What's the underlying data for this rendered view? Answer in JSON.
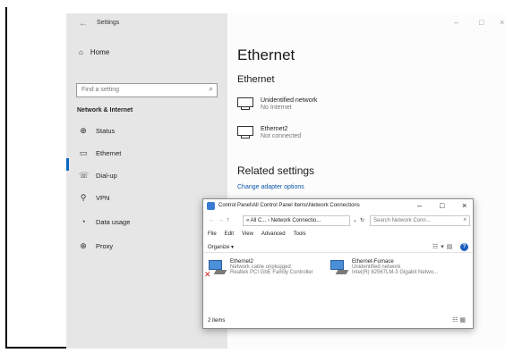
{
  "settings": {
    "window_title": "Settings",
    "home_label": "Home",
    "search_placeholder": "Find a setting",
    "section_title": "Network & Internet",
    "nav_items": [
      {
        "label": "Status",
        "icon": "globe-icon"
      },
      {
        "label": "Ethernet",
        "icon": "ethernet-icon",
        "selected": true
      },
      {
        "label": "Dial-up",
        "icon": "dialup-icon"
      },
      {
        "label": "VPN",
        "icon": "vpn-icon"
      },
      {
        "label": "Data usage",
        "icon": "data-usage-icon"
      },
      {
        "label": "Proxy",
        "icon": "proxy-icon"
      }
    ],
    "page_title": "Ethernet",
    "page_subtitle": "Ethernet",
    "networks": [
      {
        "name": "Unidentified network",
        "status": "No Internet"
      },
      {
        "name": "Ethernet2",
        "status": "Not connected"
      }
    ],
    "related_title": "Related settings",
    "change_adapter_link": "Change adapter options",
    "accent_color": "#0a67c2"
  },
  "explorer": {
    "title": "Control Panel\\All Control Panel Items\\Network Connections",
    "address": "« All C... › Network Connectio...",
    "search_placeholder": "Search Network Conn...",
    "menu": [
      "File",
      "Edit",
      "View",
      "Advanced",
      "Tools"
    ],
    "organize_label": "Organize ▾",
    "adapters": [
      {
        "name": "Ethernet2",
        "line1": "Network cable unplugged",
        "line2": "Realtek PCI GbE Family Controller",
        "disconnected": true
      },
      {
        "name": "Ethernet-Furnace",
        "line1": "Unidentified network",
        "line2": "Intel(R) 82567LM-3 Gigabit Netwo...",
        "disconnected": false
      }
    ],
    "status_text": "2 items"
  }
}
